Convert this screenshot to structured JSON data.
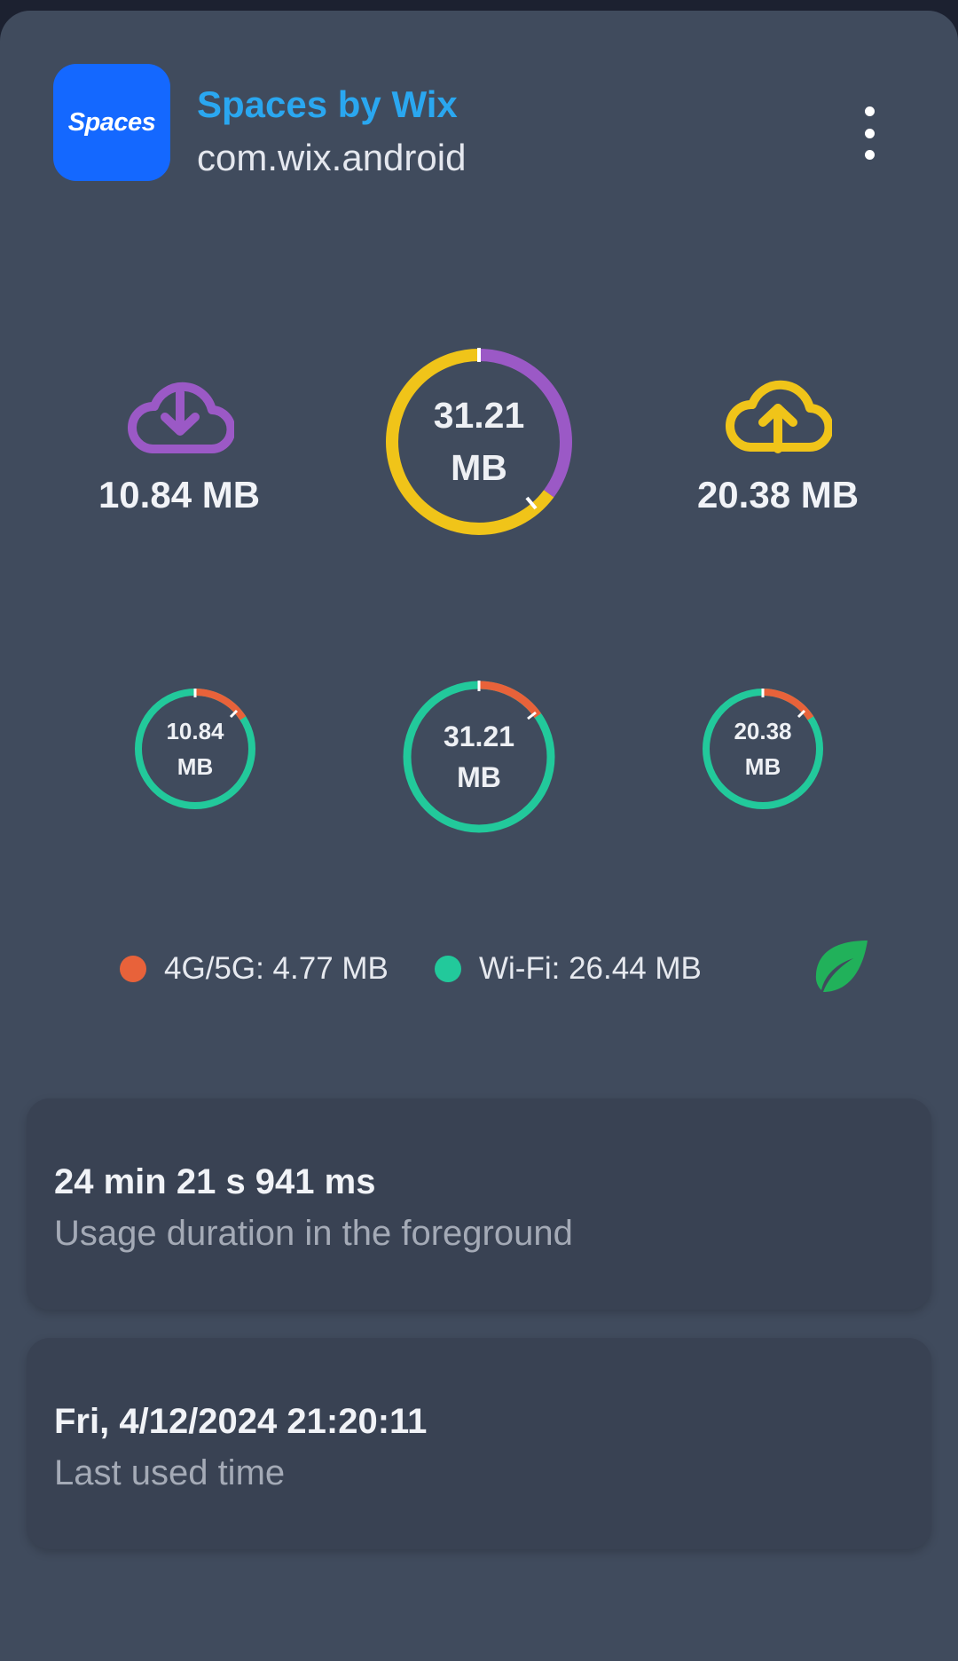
{
  "header": {
    "icon_text": "Spaces",
    "app_name": "Spaces by Wix",
    "package": "com.wix.android",
    "icon_color": "#1468ff"
  },
  "summary": {
    "download_value": "10.84 MB",
    "upload_value": "20.38 MB",
    "total_value": "31.21",
    "total_unit": "MB",
    "download_color": "#9b59c6",
    "upload_color": "#f0c419"
  },
  "network_rings": {
    "download": {
      "value": "10.84",
      "unit": "MB"
    },
    "total": {
      "value": "31.21",
      "unit": "MB"
    },
    "upload": {
      "value": "20.38",
      "unit": "MB"
    },
    "mobile_color": "#e8623a",
    "wifi_color": "#22c99b"
  },
  "legend": {
    "mobile": "4G/5G: 4.77 MB",
    "wifi": "Wi-Fi: 26.44 MB"
  },
  "icons": [
    "cloud-download-icon",
    "cloud-upload-icon",
    "more-vert-icon",
    "leaf-icon"
  ],
  "cards": {
    "duration": {
      "title": "24 min 21 s 941 ms",
      "subtitle": "Usage duration in the foreground"
    },
    "last_used": {
      "title": "Fri, 4/12/2024 21:20:11",
      "subtitle": "Last used time"
    }
  }
}
